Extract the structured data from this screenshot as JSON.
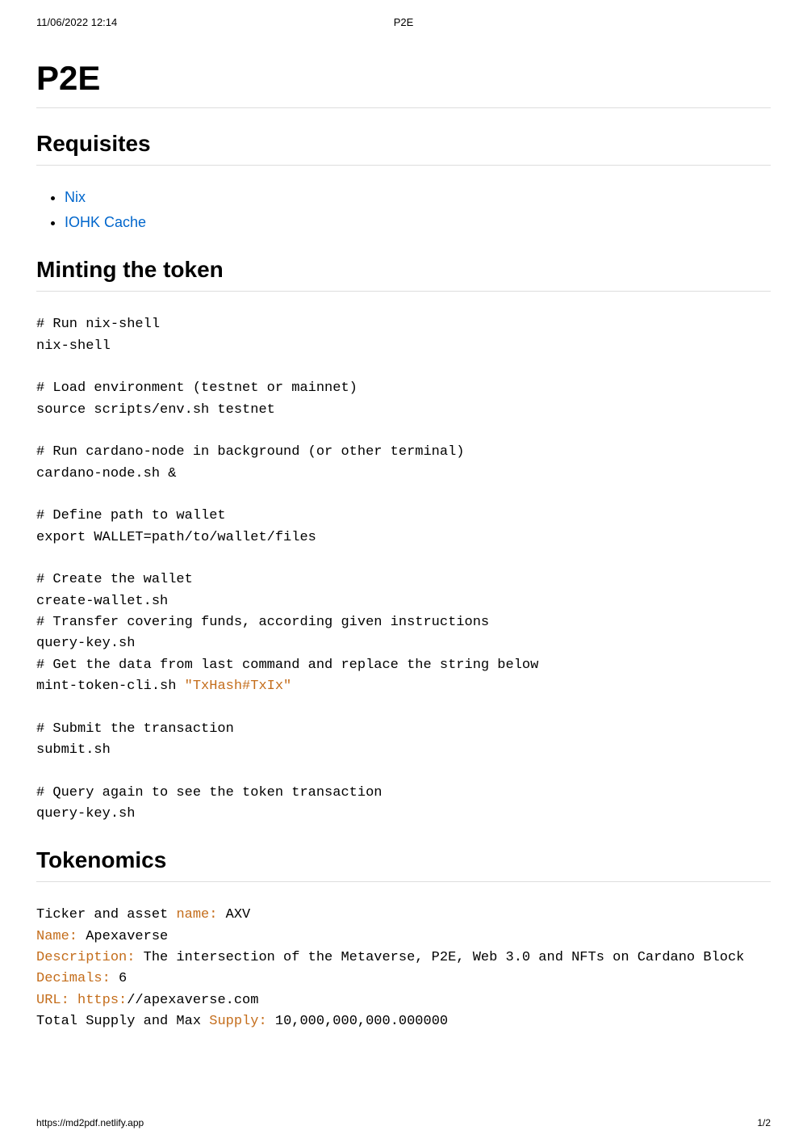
{
  "header": {
    "timestamp": "11/06/2022 12:14",
    "title": "P2E"
  },
  "page": {
    "title": "P2E"
  },
  "sections": {
    "requisites": {
      "heading": "Requisites",
      "links": [
        {
          "label": "Nix"
        },
        {
          "label": "IOHK Cache"
        }
      ]
    },
    "minting": {
      "heading": "Minting the token",
      "code": {
        "c1": "# Run nix-shell",
        "l1": "nix-shell",
        "c2": "# Load environment (testnet or mainnet)",
        "l2": "source scripts/env.sh testnet",
        "c3": "# Run cardano-node in background (or other terminal)",
        "l3": "cardano-node.sh &",
        "c4": "# Define path to wallet",
        "l4": "export WALLET=path/to/wallet/files",
        "c5": "# Create the wallet",
        "l5": "create-wallet.sh",
        "c6": "# Transfer covering funds, according given instructions",
        "l6": "query-key.sh",
        "c7": "# Get the data from last command and replace the string below",
        "l7a": "mint-token-cli.sh ",
        "l7b": "\"TxHash#TxIx\"",
        "c8": "# Submit the transaction",
        "l8": "submit.sh",
        "c9": "# Query again to see the token transaction",
        "l9": "query-key.sh"
      }
    },
    "tokenomics": {
      "heading": "Tokenomics",
      "lines": {
        "l1a": "Ticker and asset ",
        "l1k": "name:",
        "l1v": " AXV",
        "l2k": "Name:",
        "l2v": " Apexaverse",
        "l3k": "Description:",
        "l3v": " The intersection of the Metaverse, P2E, Web 3.0 and NFTs on Cardano Block",
        "l4k": "Decimals:",
        "l4v": " 6",
        "l5k": "URL:",
        "l5k2": " https:",
        "l5v": "//apexaverse.com",
        "l6a": "Total Supply and Max ",
        "l6k": "Supply:",
        "l6v": " 10,000,000,000.000000"
      }
    }
  },
  "footer": {
    "url": "https://md2pdf.netlify.app",
    "page": "1/2"
  }
}
